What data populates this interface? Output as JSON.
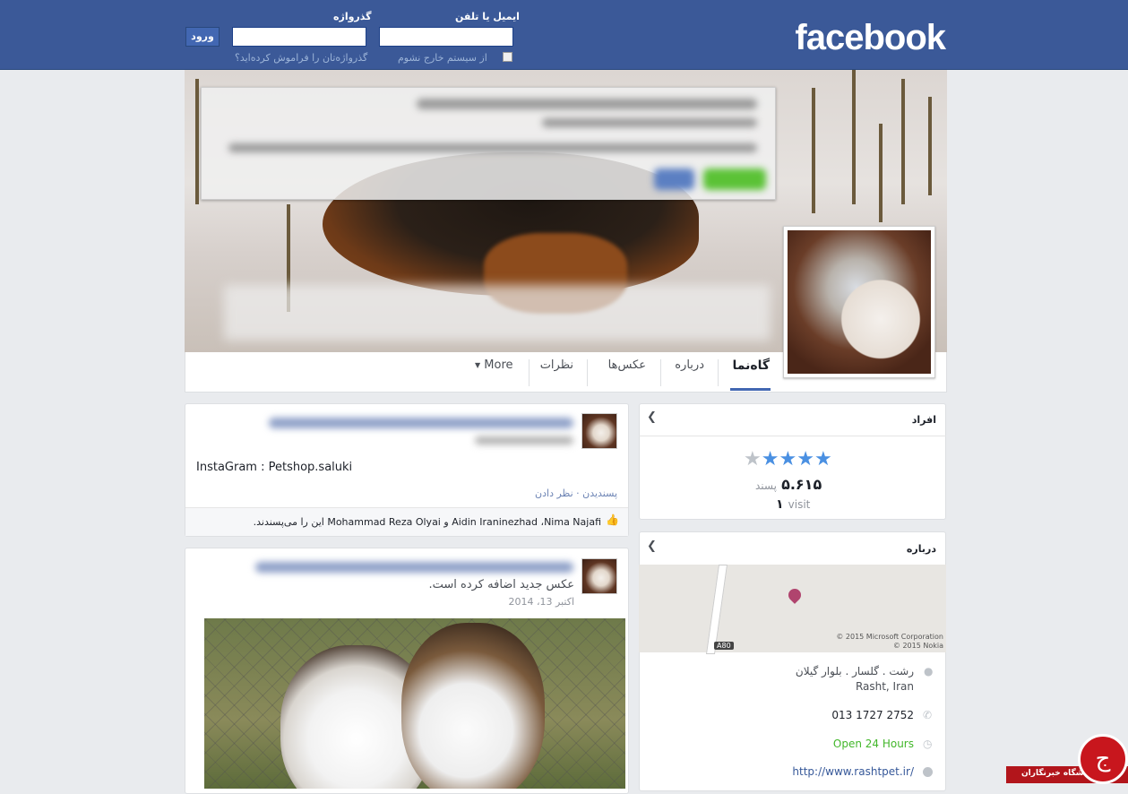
{
  "header": {
    "logo": "facebook",
    "email_label": "ایمیل یا تلفن",
    "password_label": "گذرواژه",
    "login_button": "ورود",
    "keep_logged_in": "از سیستم خارج نشوم",
    "forgot_password": "گذرواژه‌تان را فراموش کرده‌اید؟"
  },
  "tabs": {
    "timeline": "گاه‌نما",
    "about": "درباره",
    "photos": "عکس‌ها",
    "reviews": "نظرات",
    "more": "More"
  },
  "people_card": {
    "title": "افراد",
    "rating_stars": 4,
    "likes_count": "۵.۶۱۵",
    "likes_label": "پسند",
    "visits_count": "۱",
    "visits_label": "visit"
  },
  "about_card": {
    "title": "درباره",
    "map_credit_1": "© 2015 Microsoft Corporation",
    "map_credit_2": "© 2015 Nokia",
    "road_label": "A80",
    "address_line1": "رشت . گلسار . بلوار گیلان",
    "address_line2": "Rasht, Iran",
    "phone": "013 1727 2752",
    "hours": "Open 24 Hours",
    "website": "http://www.rashtpet.ir/"
  },
  "post1": {
    "text": "InstaGram : Petshop.saluki",
    "actions": "پسندیدن · نظر دادن",
    "likers_text": "Aidin Iraninezhad ،Nima Najafi و Mohammad Reza Olyai این را می‌پسندند."
  },
  "post2": {
    "action_text": "عکس جدید اضافه کرده است.",
    "date": "اکتبر 13، 2014"
  },
  "watermark": {
    "text": "باشگاه خبرنگاران"
  },
  "colors": {
    "header_blue": "#3b5998",
    "link_blue": "#365899",
    "star_blue": "#4a90e2",
    "open_green": "#42b72a"
  }
}
